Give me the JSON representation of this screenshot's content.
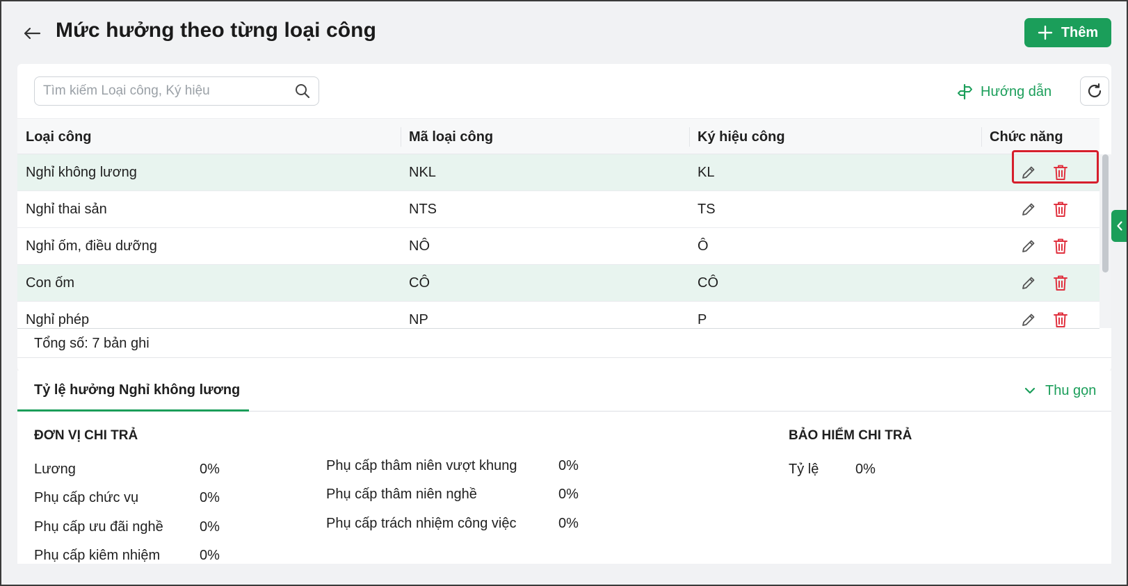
{
  "header": {
    "title": "Mức hưởng theo từng loại công",
    "add_label": "Thêm"
  },
  "toolbar": {
    "search_placeholder": "Tìm kiếm Loại công, Ký hiệu",
    "guide_label": "Hướng dẫn"
  },
  "table": {
    "columns": [
      "Loại công",
      "Mã loại công",
      "Ký hiệu công",
      "Chức năng"
    ],
    "rows": [
      {
        "loai_cong": "Nghỉ không lương",
        "ma": "NKL",
        "ky_hieu": "KL"
      },
      {
        "loai_cong": "Nghỉ thai sản",
        "ma": "NTS",
        "ky_hieu": "TS"
      },
      {
        "loai_cong": "Nghỉ ốm, điều dưỡng",
        "ma": "NÔ",
        "ky_hieu": "Ô"
      },
      {
        "loai_cong": "Con ốm",
        "ma": "CÔ",
        "ky_hieu": "CÔ"
      },
      {
        "loai_cong": "Nghỉ phép",
        "ma": "NP",
        "ky_hieu": "P"
      }
    ],
    "total_text": "Tổng số: 7 bản ghi"
  },
  "detail": {
    "tab_label": "Tỷ lệ hưởng Nghỉ không lương",
    "collapse_label": "Thu gọn",
    "don_vi": {
      "title": "ĐƠN VỊ CHI TRẢ",
      "col1": [
        {
          "label": "Lương",
          "value": "0%"
        },
        {
          "label": "Phụ cấp chức vụ",
          "value": "0%"
        },
        {
          "label": "Phụ cấp ưu đãi nghề",
          "value": "0%"
        },
        {
          "label": "Phụ cấp kiêm nhiệm",
          "value": "0%"
        }
      ],
      "col2": [
        {
          "label": "Phụ cấp thâm niên vượt khung",
          "value": "0%"
        },
        {
          "label": "Phụ cấp thâm niên nghề",
          "value": "0%"
        },
        {
          "label": "Phụ cấp trách nhiệm công việc",
          "value": "0%"
        }
      ]
    },
    "bao_hiem": {
      "title": "BẢO HIỂM CHI TRẢ",
      "items": [
        {
          "label": "Tỷ lệ",
          "value": "0%"
        }
      ]
    }
  },
  "icons": {
    "back": "arrow-left-icon",
    "add": "plus-icon",
    "search": "search-icon",
    "guide": "signpost-icon",
    "refresh": "refresh-icon",
    "edit": "pencil-icon",
    "delete": "trash-icon",
    "collapse": "chevron-down-icon",
    "side": "chevron-left-icon"
  },
  "colors": {
    "accent": "#1b9e5a",
    "delete": "#e0313f",
    "highlight": "#d61f2c",
    "row_alt": "#e8f4ef"
  }
}
